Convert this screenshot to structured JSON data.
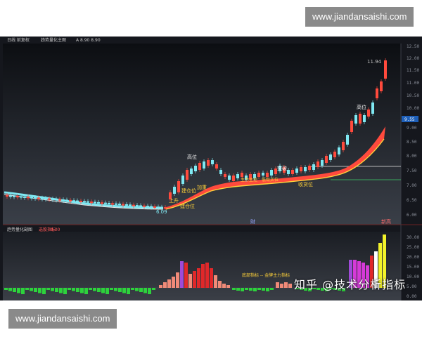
{
  "watermark": {
    "top": "www.jiandansaishi.com",
    "bottom": "www.jiandansaishi.com"
  },
  "main_panel": {
    "title_left": "日线 前复权",
    "indicator_name": "趋势量化主图",
    "indicator_values": "A 8.90   8.90",
    "price_axis": [
      "12.50",
      "12.00",
      "11.50",
      "11.00",
      "10.50",
      "10.00",
      "9.50",
      "9.00",
      "8.50",
      "8.00",
      "7.50",
      "7.00",
      "6.50",
      "6.00"
    ],
    "current_price_tag": "9.55",
    "annotations": {
      "high_price": "11.94",
      "top_label_right": "高位",
      "top_label_mid": "高位",
      "label_mid_right": "突破",
      "label_rise": "上升",
      "label_low": "6.09",
      "label_support_1": "建仓位",
      "label_support_2": "建仓位",
      "label_support_3": "收货位",
      "label_weight": "加重",
      "label_center": "主力主控",
      "label_center2": "低吸买位",
      "date_marker": "財",
      "right_tag": "新高"
    },
    "colors": {
      "ribbon_upper": "#ff4a3d",
      "ribbon_lower": "#ff9a3a",
      "ribbon_line": "#ffd23a",
      "cyan": "#7fe8f2",
      "green_line": "#3fd06b",
      "white_line": "#e8e8e8"
    }
  },
  "sub_panel": {
    "title": "趋势量化副图",
    "tag": "选股指标",
    "tag_value": "0.00",
    "axis": [
      "30.00",
      "25.00",
      "20.00",
      "15.00",
      "10.00",
      "5.00",
      "0.00"
    ],
    "annotation": "底部指标 -- 金牌主力指标",
    "colors": {
      "bear": "#2dd23c",
      "salmon": "#f08a78",
      "red": "#e0282a",
      "purple": "#a04ad8",
      "magenta": "#d63ad8",
      "yellow": "#f2f22a"
    }
  },
  "overlay_text": "知乎 @技术分析指标"
}
